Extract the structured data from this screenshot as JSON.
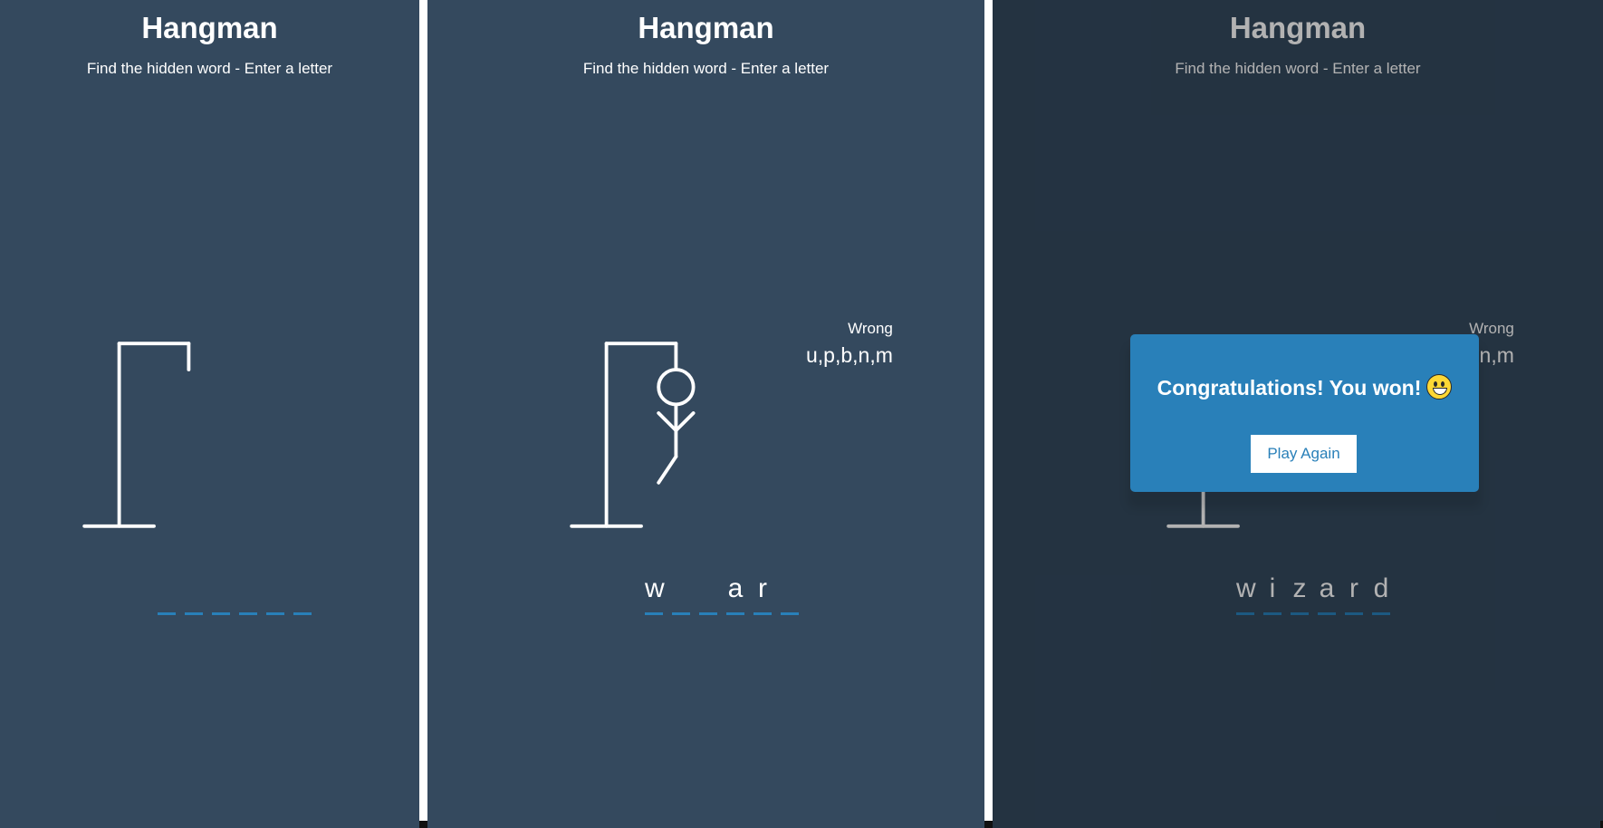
{
  "game": {
    "title": "Hangman",
    "subtitle": "Find the hidden word - Enter a letter",
    "wrong_label": "Wrong"
  },
  "colors": {
    "background": "#34495e",
    "accent": "#2980b9",
    "figure": "#ffffff"
  },
  "screens": [
    {
      "id": "start",
      "word_letters": [
        "",
        "",
        "",
        "",
        "",
        ""
      ],
      "wrong_letters": "",
      "figure_parts_shown": 0,
      "icons": [
        "gallows-icon"
      ]
    },
    {
      "id": "in-progress",
      "word_letters": [
        "w",
        "",
        "",
        "a",
        "r",
        ""
      ],
      "wrong_letters": "u,p,b,n,m",
      "figure_parts_shown": 5,
      "icons": [
        "gallows-icon",
        "hangman-figure-icon"
      ]
    },
    {
      "id": "won",
      "word_letters": [
        "w",
        "i",
        "z",
        "a",
        "r",
        "d"
      ],
      "wrong_letters": "u,p,b,n,m",
      "figure_parts_shown": 5,
      "icons": [
        "gallows-icon",
        "hangman-figure-icon",
        "grinning-face-emoji"
      ],
      "popup": {
        "message": "Congratulations! You won!",
        "button_label": "Play Again"
      }
    }
  ]
}
